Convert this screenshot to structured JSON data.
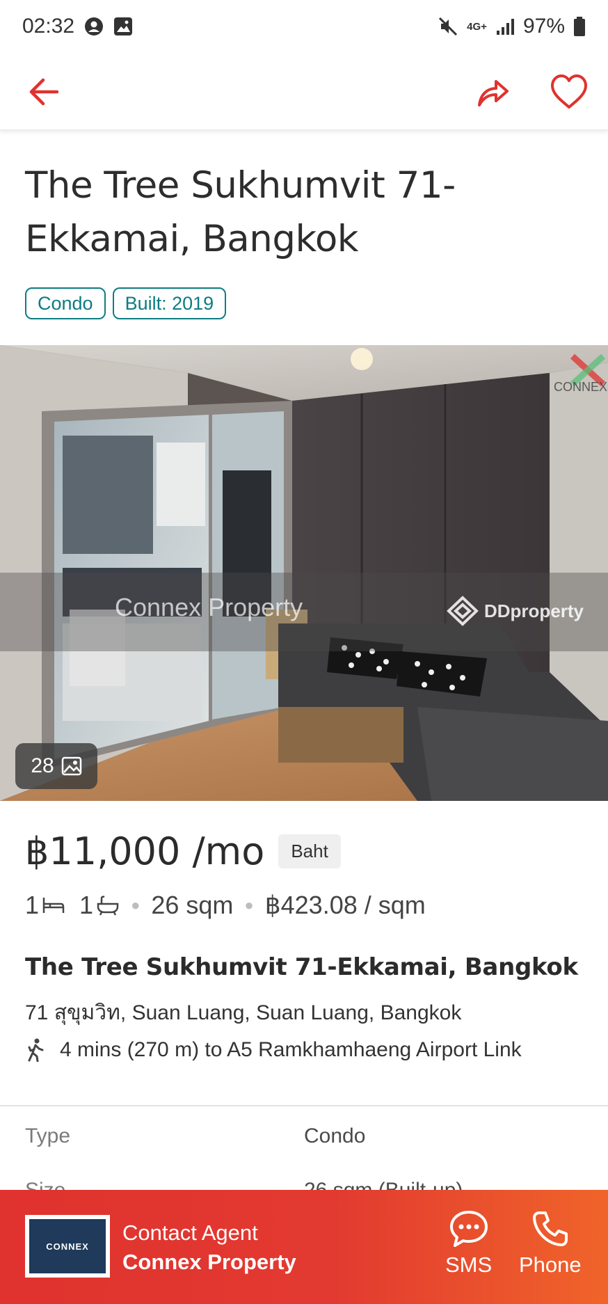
{
  "status_bar": {
    "time": "02:32",
    "network": "4G+",
    "battery": "97%"
  },
  "header": {
    "icons": [
      "back-arrow-icon",
      "share-icon",
      "heart-icon"
    ]
  },
  "listing": {
    "title": "The Tree Sukhumvit 71-Ekkamai, Bangkok",
    "tags": [
      "Condo",
      "Built: 2019"
    ],
    "photo": {
      "count": "28",
      "watermark_left": "Connex Property",
      "watermark_right": "DDproperty",
      "corner_logo": "CONNEX"
    },
    "price": "฿11,000 /mo",
    "currency": "Baht",
    "specs": {
      "beds": "1",
      "baths": "1",
      "size": "26 sqm",
      "price_per_sqm": "฿423.08 / sqm"
    },
    "location": {
      "name": "The Tree Sukhumvit 71-Ekkamai, Bangkok",
      "address": "71 สุขุมวิท, Suan Luang, Suan Luang, Bangkok",
      "transit": "4 mins (270 m) to A5 Ramkhamhaeng Airport Link"
    },
    "details": [
      {
        "key": "Type",
        "value": "Condo"
      },
      {
        "key": "Size",
        "value": "26 sqm (Built-up)"
      }
    ]
  },
  "contact": {
    "label": "Contact Agent",
    "agent": "Connex Property",
    "agent_logo_text": "CONNEX",
    "sms_label": "SMS",
    "phone_label": "Phone"
  },
  "colors": {
    "accent": "#e0322f",
    "tag": "#0d7c83"
  }
}
